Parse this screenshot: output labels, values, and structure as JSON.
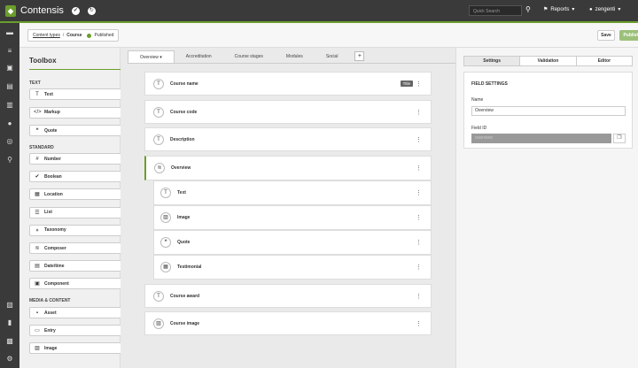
{
  "app": {
    "name": "Contensis"
  },
  "topbar": {
    "search_placeholder": "Quick Search",
    "reports_label": "Reports",
    "user_label": "zengenti"
  },
  "breadcrumb": {
    "content_types": "Content types",
    "separator": "/",
    "current": "Course",
    "status": "Published"
  },
  "actions": {
    "save": "Save",
    "publish": "Publish",
    "more": "⋮"
  },
  "toolbox": {
    "title": "Toolbox",
    "sections": {
      "text": "TEXT",
      "standard": "STANDARD",
      "media": "MEDIA & CONTENT"
    },
    "text_items": [
      {
        "label": "Text",
        "icon": "T"
      },
      {
        "label": "Markup",
        "icon": "</>"
      },
      {
        "label": "Quote",
        "icon": "❝"
      }
    ],
    "standard_items": [
      {
        "label": "Number",
        "icon": "#"
      },
      {
        "label": "Boolean",
        "icon": "✔"
      },
      {
        "label": "Location",
        "icon": "▦"
      },
      {
        "label": "List",
        "icon": "☰"
      },
      {
        "label": "Taxonomy",
        "icon": "⋄"
      },
      {
        "label": "Composer",
        "icon": "≋"
      },
      {
        "label": "Date/time",
        "icon": "▤"
      },
      {
        "label": "Component",
        "icon": "▣"
      }
    ],
    "media_items": [
      {
        "label": "Asset",
        "icon": "▪"
      },
      {
        "label": "Entry",
        "icon": "▭"
      },
      {
        "label": "Image",
        "icon": "▨"
      }
    ]
  },
  "tabs": [
    {
      "label": "Overview"
    },
    {
      "label": "Accreditation"
    },
    {
      "label": "Course stages"
    },
    {
      "label": "Modules"
    },
    {
      "label": "Social"
    }
  ],
  "tab_add": "+",
  "fields": [
    {
      "label": "Course name",
      "icon": "T",
      "tag": "Title"
    },
    {
      "label": "Course code",
      "icon": "T"
    },
    {
      "label": "Description",
      "icon": "T"
    },
    {
      "label": "Overview",
      "icon": "≋"
    }
  ],
  "subfields": [
    {
      "label": "Text",
      "icon": "T"
    },
    {
      "label": "Image",
      "icon": "▨"
    },
    {
      "label": "Quote",
      "icon": "❝"
    },
    {
      "label": "Testimonial",
      "icon": "▦"
    }
  ],
  "fields_after": [
    {
      "label": "Course award",
      "icon": "T"
    },
    {
      "label": "Course image",
      "icon": "▨"
    }
  ],
  "right_panel": {
    "tabs": [
      "Settings",
      "Validation",
      "Editor"
    ],
    "section_title": "FIELD SETTINGS",
    "name_label": "Name",
    "name_value": "Overview",
    "field_id_label": "Field ID",
    "field_id_value": "overview"
  },
  "colors": {
    "brand_green": "#6b9e2d",
    "topbar": "#3a3a3a"
  }
}
